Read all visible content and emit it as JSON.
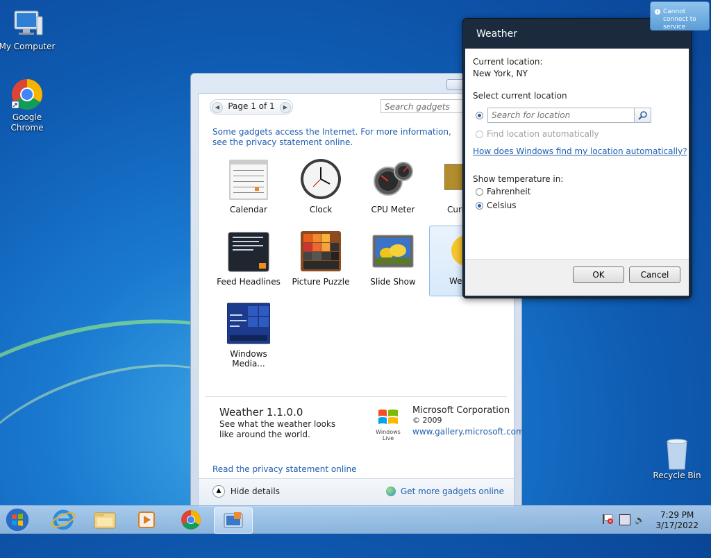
{
  "desktop": {
    "icons": [
      {
        "label": "My Computer"
      },
      {
        "label": "Google Chrome"
      },
      {
        "label": "Recycle Bin"
      }
    ]
  },
  "gallery": {
    "pager_label": "Page 1 of 1",
    "search_placeholder": "Search gadgets",
    "info_text": "Some gadgets access the Internet.  For more information, see the privacy statement online.",
    "gadgets": [
      {
        "label": "Calendar"
      },
      {
        "label": "Clock"
      },
      {
        "label": "CPU Meter"
      },
      {
        "label": "Curr"
      },
      {
        "label": "Feed Headlines"
      },
      {
        "label": "Picture Puzzle"
      },
      {
        "label": "Slide Show"
      },
      {
        "label": "Wea"
      },
      {
        "label": "Windows Media..."
      }
    ],
    "details": {
      "title": "Weather 1.1.0.0",
      "description": "See what the weather looks like around the world.",
      "publisher": "Microsoft Corporation",
      "copyright": "© 2009",
      "link": "www.gallery.microsoft.com",
      "windows_live": "Windows Live",
      "privacy_link": "Read the privacy statement online"
    },
    "hide_details": "Hide details",
    "more_gadgets": "Get more gadgets online"
  },
  "weather_dialog": {
    "title": "Weather",
    "current_location_label": "Current location:",
    "current_location": "New York, NY",
    "select_location_label": "Select current location",
    "search_placeholder": "Search for location",
    "find_auto_label": "Find location automatically",
    "how_link": "How does Windows find my location automatically?",
    "temp_label": "Show temperature in:",
    "fahrenheit": "Fahrenheit",
    "celsius": "Celsius",
    "selected_unit": "Celsius",
    "ok": "OK",
    "cancel": "Cancel"
  },
  "notification": {
    "text": "Cannot connect to service"
  },
  "taskbar": {
    "time": "7:29 PM",
    "date": "3/17/2022"
  }
}
